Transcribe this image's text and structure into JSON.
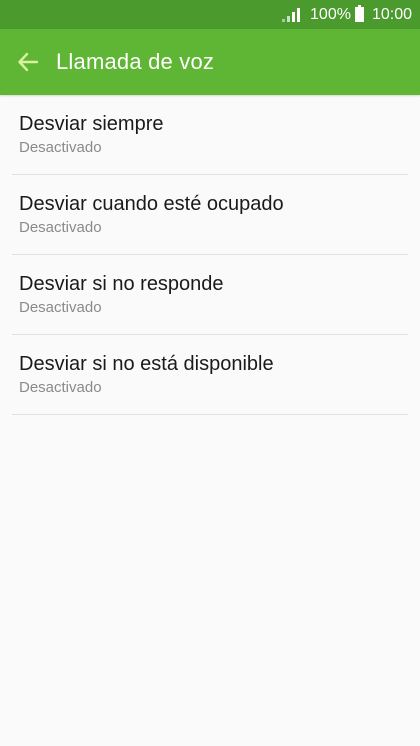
{
  "status_bar": {
    "battery_percent": "100%",
    "time": "10:00",
    "icons": [
      "signal-icon",
      "battery-icon"
    ]
  },
  "app_bar": {
    "title": "Llamada de voz",
    "back_icon": "arrow-left-icon"
  },
  "settings": [
    {
      "title": "Desviar siempre",
      "subtitle": "Desactivado"
    },
    {
      "title": "Desviar cuando esté ocupado",
      "subtitle": "Desactivado"
    },
    {
      "title": "Desviar si no responde",
      "subtitle": "Desactivado"
    },
    {
      "title": "Desviar si no está disponible",
      "subtitle": "Desactivado"
    }
  ],
  "colors": {
    "status_bar": "#4a9a2e",
    "app_bar": "#5fb534",
    "back_arrow": "#d9f2a0"
  }
}
